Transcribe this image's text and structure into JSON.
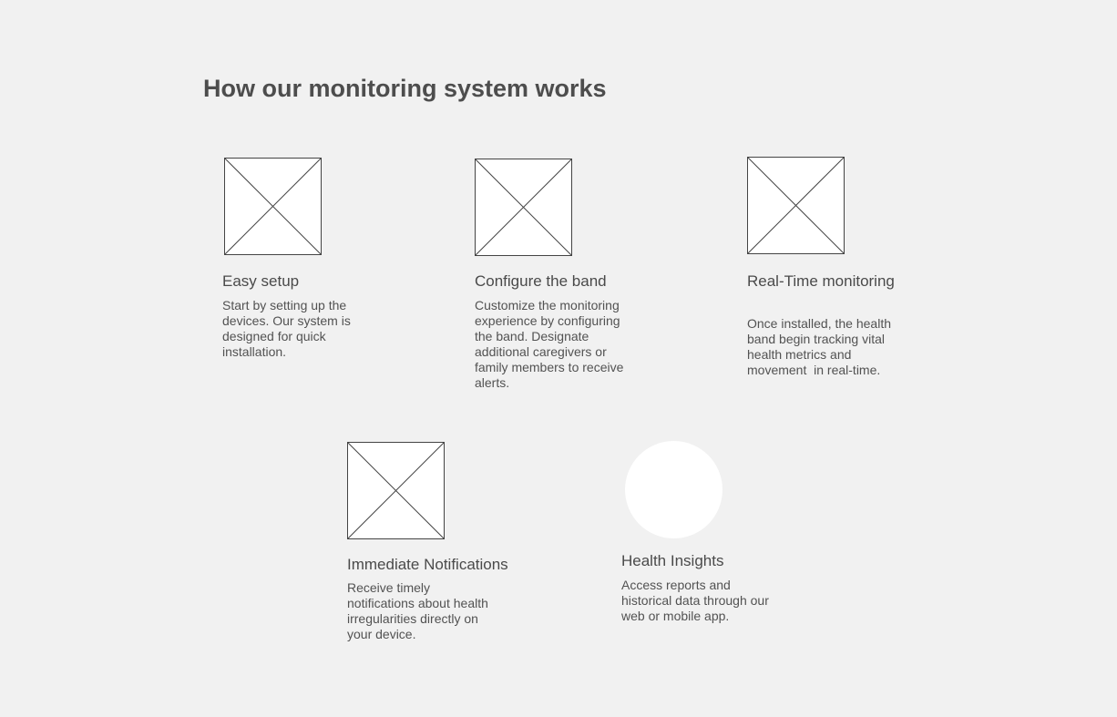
{
  "page": {
    "title": "How our monitoring system works"
  },
  "features": [
    {
      "title": "Easy setup",
      "lines": [
        "Start by setting up the",
        "devices. Our system is",
        "designed for quick",
        "installation."
      ],
      "image": "image-placeholder-icon"
    },
    {
      "title": "Configure the band",
      "lines": [
        "Customize the monitoring",
        "experience by configuring",
        "the band. Designate",
        "additional caregivers or",
        "family members to receive",
        "alerts."
      ],
      "image": "image-placeholder-icon"
    },
    {
      "title": "Real-Time monitoring",
      "lines": [
        "Once installed, the health",
        "band begin tracking vital",
        "health metrics and",
        "movement  in real-time."
      ],
      "image": "image-placeholder-icon"
    },
    {
      "title": "Immediate Notifications",
      "lines": [
        "Receive timely",
        "notifications about health",
        "irregularities directly on",
        "your device."
      ],
      "image": "image-placeholder-icon"
    },
    {
      "title": "Health Insights",
      "lines": [
        "Access reports and",
        "historical data through our",
        "web or mobile app."
      ],
      "image": "circle-placeholder-icon"
    }
  ],
  "colors": {
    "background": "#f1f1f1",
    "placeholder_fill": "#ffffff",
    "placeholder_stroke": "#444444",
    "text": "#4a4a4a"
  }
}
